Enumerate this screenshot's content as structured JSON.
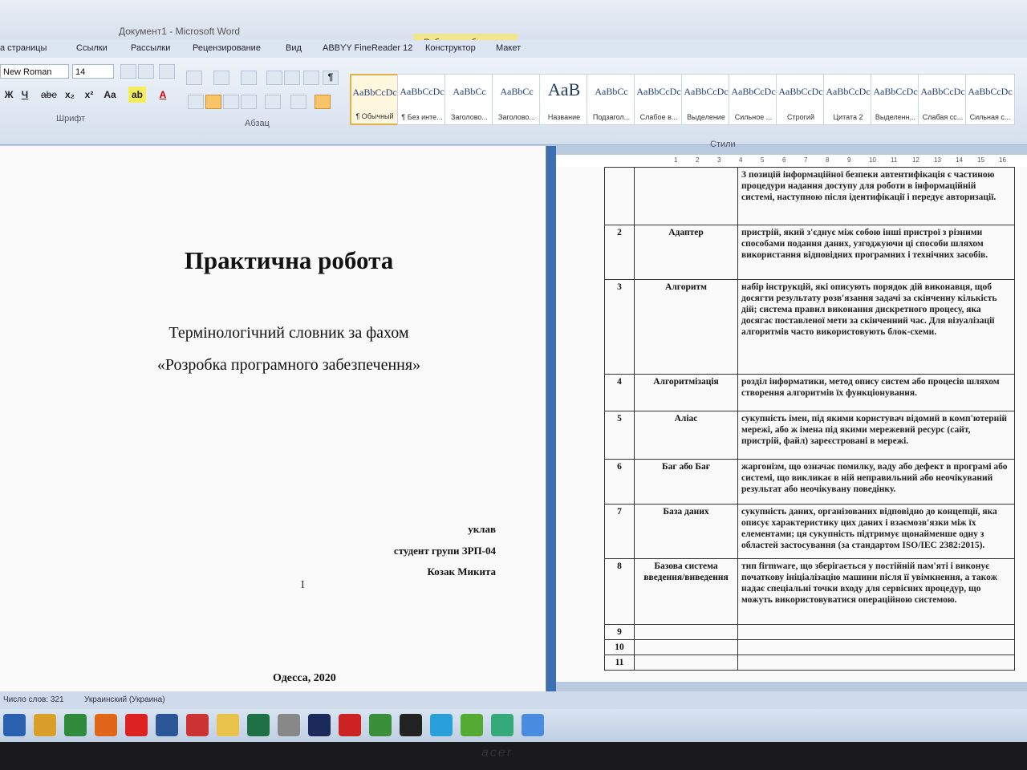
{
  "window": {
    "title": "Документ1 - Microsoft Word",
    "context_tools": "Работа с таблицами"
  },
  "tabs": [
    "а страницы",
    "Ссылки",
    "Рассылки",
    "Рецензирование",
    "Вид",
    "ABBYY FineReader 12",
    "Конструктор",
    "Макет"
  ],
  "ribbon": {
    "font_name": "New Roman",
    "font_size": "14",
    "font_group_label": "Шрифт",
    "paragraph_group_label": "Абзац",
    "styles_group_label": "Стили",
    "format_buttons": [
      "Ж",
      "Ч",
      "abe",
      "x₂",
      "x²",
      "Aa",
      "A"
    ],
    "styles": [
      {
        "sample": "AaBbCcDc",
        "name": "¶ Обычный",
        "selected": true
      },
      {
        "sample": "AaBbCcDc",
        "name": "¶ Без инте..."
      },
      {
        "sample": "AaBbCc",
        "name": "Заголово..."
      },
      {
        "sample": "AaBbCc",
        "name": "Заголово..."
      },
      {
        "sample": "AaB",
        "name": "Название",
        "big": true
      },
      {
        "sample": "AaBbCc",
        "name": "Подзагол..."
      },
      {
        "sample": "AaBbCcDc",
        "name": "Слабое в..."
      },
      {
        "sample": "AaBbCcDc",
        "name": "Выделение"
      },
      {
        "sample": "AaBbCcDc",
        "name": "Сильное ..."
      },
      {
        "sample": "AaBbCcDc",
        "name": "Строгий"
      },
      {
        "sample": "AaBbCcDc",
        "name": "Цитата 2"
      },
      {
        "sample": "AaBbCcDc",
        "name": "Выделенн..."
      },
      {
        "sample": "AaBbCcDc",
        "name": "Слабая сс..."
      },
      {
        "sample": "AaBbCcDc",
        "name": "Сильная с..."
      }
    ]
  },
  "ruler": [
    "1",
    "2",
    "3",
    "4",
    "5",
    "6",
    "7",
    "8",
    "9",
    "10",
    "11",
    "12",
    "13",
    "14",
    "15",
    "16"
  ],
  "title_page": {
    "title": "Практична робота",
    "subtitle_line1": "Термінологічний словник за фахом",
    "subtitle_line2": "«Розробка програмного забезпечення»",
    "compiled_label": "уклав",
    "student_group": "студент групи ЗРП-04",
    "student_name": "Козак Микита",
    "city_year": "Одесса, 2020"
  },
  "glossary": [
    {
      "num": "",
      "term": "",
      "def": "З позицій інформаційної безпеки автентифікація є частиною процедури надання доступу для роботи в інформаційній системі, наступною після ідентифікації і передує авторизації."
    },
    {
      "num": "2",
      "term": "Адаптер",
      "def": "пристрій, який з'єднує між собою інші пристрої з різними способами подання даних, узгоджуючи ці способи шляхом використання відповідних програмних і технічних засобів."
    },
    {
      "num": "3",
      "term": "Алгоритм",
      "def": "набір інструкцій, які описують порядок дій виконавця, щоб досягти результату розв'язання задачі за скінченну кількість дій; система правил виконання дискретного процесу, яка досягає поставленої мети за скінченний час. Для візуалізації алгоритмів часто використовують блок-схеми."
    },
    {
      "num": "4",
      "term": "Алгоритмізація",
      "def": "розділ інформатики, метод опису систем або процесів шляхом створення алгоритмів їх функціонування."
    },
    {
      "num": "5",
      "term": "Аліас",
      "def": "сукупність імен, під якими користувач відомий в комп'ютерній мережі, або ж імена під якими мережевий ресурс (сайт, пристрій, файл) зареєстровані в мережі."
    },
    {
      "num": "6",
      "term": "Баг або Бағ",
      "def": "жаргонізм, що означає помилку, ваду або дефект в програмі або системі, що викликає в ній неправильний або неочікуваний результат або неочікувану поведінку."
    },
    {
      "num": "7",
      "term": "База даних",
      "def": "сукупність даних, організованих відповідно до концепції, яка описує характеристику цих даних і взаємозв'язки між їх елементами; ця сукупність підтримує щонайменше одну з областей застосування (за стандартом ISO/IEC 2382:2015)."
    },
    {
      "num": "8",
      "term": "Базова система введення/виведення",
      "def": "тип firmware, що зберігається у постійній пам'яті і виконує початкову ініціалізацію машини після її увімкнення, а також надає спеціальні точки входу для сервісних процедур, що можуть використовуватися операційною системою."
    },
    {
      "num": "9",
      "term": "",
      "def": ""
    },
    {
      "num": "10",
      "term": "",
      "def": ""
    },
    {
      "num": "11",
      "term": "",
      "def": ""
    }
  ],
  "status": {
    "words": "Число слов: 321",
    "language": "Украинский (Украина)"
  },
  "taskbar_icons": [
    "save-icon",
    "chrome-icon",
    "excel-icon",
    "firefox-icon",
    "opera-icon",
    "word-icon",
    "reader-icon",
    "folder-icon",
    "xls-icon",
    "file-icon",
    "photoshop-icon",
    "app-icon",
    "app2-icon",
    "miro-icon",
    "telegram-icon",
    "app3-icon",
    "app4-icon",
    "app5-icon"
  ],
  "bezel_brand": "acer"
}
